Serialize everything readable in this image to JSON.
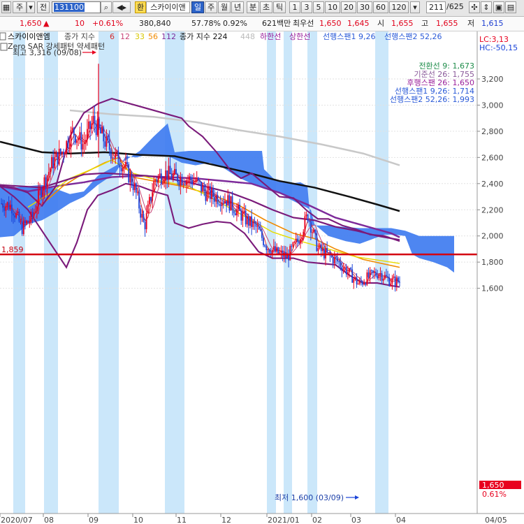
{
  "toolbar": {
    "market": "주",
    "prefix": "전",
    "code": "131100",
    "won_label": "환",
    "stock_name": "스카이이앤",
    "periods": [
      "일",
      "주",
      "월",
      "년",
      "분",
      "초",
      "틱"
    ],
    "intervals": [
      "1",
      "3",
      "5",
      "10",
      "20",
      "30",
      "60",
      "120"
    ],
    "page_current": "211",
    "page_total": "/625"
  },
  "quote": {
    "price": "1,650",
    "change_arrow": "▲",
    "change": "10",
    "change_pct": "+0.61%",
    "volume": "380,840",
    "turnover_pct": "57.78%",
    "ratio_pct": "0.92%",
    "amount": "621백만",
    "bid_label": "최우선",
    "bid1": "1,650",
    "bid2": "1,645",
    "open_label": "시",
    "open": "1,655",
    "high_label": "고",
    "high": "1,655",
    "low_label": "저",
    "low": "1,615"
  },
  "legend": {
    "name": "스카이이앤엠",
    "ma_label": "종가 지수",
    "ma_periods": [
      "6",
      "12",
      "33",
      "56",
      "112"
    ],
    "ma2_label": "종가 지수 224",
    "ma3_value": "448",
    "lower_band": "하한선",
    "upper_band": "상한선",
    "span1_label": "선행스팬1 9,26",
    "span2_label": "선행스팬2 52,26",
    "line2": "Zero SAR 강세패턴  약세패턴",
    "peak_label": "최고 3,316 (09/08)",
    "low_label": "최저 1,600 (03/09)",
    "lc": "LC:3,13",
    "hc": "HC:-50,15",
    "ichimoku": [
      "전환선 9: 1,673",
      "기준선 26: 1,755",
      "후행스팬 26: 1,650",
      "선행스팬1 9,26: 1,714",
      "선행스팬2 52,26: 1,993"
    ],
    "hline_label": "1,859",
    "last_price_tag": "1,650",
    "last_pct_tag": "0.61%"
  },
  "colors": {
    "up": "#e8001e",
    "down": "#1b44d8",
    "cloud": "#3f7cf0",
    "highlight": "#cbe7fa",
    "bollinger": "#7a1a7a",
    "ma6": "#d62d2d",
    "ma12": "#c84678",
    "ma33": "#e8dc00",
    "ma56": "#f08a00",
    "ma112": "#7d2a9a",
    "ma224": "#111111",
    "ma448": "#c8c8c8",
    "hline": "#d40010",
    "ichimoku_text": [
      "#1e8c4a",
      "#8a5a9a",
      "#9a1e9a",
      "#2a5ad8",
      "#2a5ad8"
    ]
  },
  "chart_data": {
    "type": "candlestick",
    "y_ticks": [
      3200,
      3000,
      2800,
      2600,
      2400,
      2200,
      2000,
      1800,
      1600
    ],
    "x_ticks": [
      "2020/07",
      "08",
      "09",
      "10",
      "11",
      "12",
      "2021/01",
      "02",
      "03",
      "04",
      "04/05"
    ],
    "ylim": [
      1580,
      3330
    ],
    "close_series": [
      {
        "x": "2020/07",
        "y": 2250
      },
      {
        "x": "2020/07",
        "y": 2230
      },
      {
        "x": "07/20",
        "y": 2060
      },
      {
        "x": "07/27",
        "y": 2140
      },
      {
        "x": "08",
        "y": 2380
      },
      {
        "x": "08/10",
        "y": 2560
      },
      {
        "x": "08/17",
        "y": 2650
      },
      {
        "x": "08/24",
        "y": 2800
      },
      {
        "x": "08/31",
        "y": 2700
      },
      {
        "x": "09/07",
        "y": 2880
      },
      {
        "x": "09/14",
        "y": 2740
      },
      {
        "x": "09/21",
        "y": 2620
      },
      {
        "x": "09/28",
        "y": 2540
      },
      {
        "x": "10/05",
        "y": 2380
      },
      {
        "x": "10/12",
        "y": 2070
      },
      {
        "x": "10/19",
        "y": 2430
      },
      {
        "x": "10/26",
        "y": 2480
      },
      {
        "x": "11/02",
        "y": 2450
      },
      {
        "x": "11/09",
        "y": 2440
      },
      {
        "x": "11/16",
        "y": 2420
      },
      {
        "x": "11/23",
        "y": 2330
      },
      {
        "x": "11/30",
        "y": 2300
      },
      {
        "x": "12/07",
        "y": 2280
      },
      {
        "x": "12/14",
        "y": 2200
      },
      {
        "x": "12/21",
        "y": 2120
      },
      {
        "x": "12/28",
        "y": 2060
      },
      {
        "x": "2021/01",
        "y": 1920
      },
      {
        "x": "01/11",
        "y": 1870
      },
      {
        "x": "01/18",
        "y": 1840
      },
      {
        "x": "01/25",
        "y": 1960
      },
      {
        "x": "02",
        "y": 2160
      },
      {
        "x": "02/08",
        "y": 1900
      },
      {
        "x": "02/15",
        "y": 1850
      },
      {
        "x": "02/22",
        "y": 1800
      },
      {
        "x": "03",
        "y": 1720
      },
      {
        "x": "03/09",
        "y": 1630
      },
      {
        "x": "03/16",
        "y": 1690
      },
      {
        "x": "03/23",
        "y": 1720
      },
      {
        "x": "03/30",
        "y": 1660
      },
      {
        "x": "04",
        "y": 1650
      }
    ],
    "ma224": [
      {
        "x": "2020/07",
        "y": 2720
      },
      {
        "x": "08",
        "y": 2620
      },
      {
        "x": "09",
        "y": 2630
      },
      {
        "x": "10",
        "y": 2620
      },
      {
        "x": "11",
        "y": 2600
      },
      {
        "x": "12",
        "y": 2540
      },
      {
        "x": "2021/01",
        "y": 2440
      },
      {
        "x": "02",
        "y": 2360
      },
      {
        "x": "03",
        "y": 2260
      },
      {
        "x": "04",
        "y": 2190
      }
    ],
    "ma448": [
      {
        "x": "08",
        "y": 2960
      },
      {
        "x": "09",
        "y": 2930
      },
      {
        "x": "10",
        "y": 2900
      },
      {
        "x": "11",
        "y": 2850
      },
      {
        "x": "12",
        "y": 2780
      },
      {
        "x": "2021/01",
        "y": 2700
      },
      {
        "x": "02",
        "y": 2640
      },
      {
        "x": "03",
        "y": 2570
      },
      {
        "x": "04",
        "y": 2530
      }
    ],
    "bollinger_upper": [
      {
        "x": "2020/07",
        "y": 2380
      },
      {
        "x": "08",
        "y": 2400
      },
      {
        "x": "09",
        "y": 3030
      },
      {
        "x": "10",
        "y": 2890
      },
      {
        "x": "11",
        "y": 2860
      },
      {
        "x": "12",
        "y": 2480
      },
      {
        "x": "2021/01",
        "y": 2390
      },
      {
        "x": "02",
        "y": 2180
      },
      {
        "x": "03",
        "y": 2080
      },
      {
        "x": "04",
        "y": 1960
      }
    ],
    "bollinger_lower": [
      {
        "x": "2020/07",
        "y": 2380
      },
      {
        "x": "08",
        "y": 1770
      },
      {
        "x": "09",
        "y": 2400
      },
      {
        "x": "10",
        "y": 2100
      },
      {
        "x": "11",
        "y": 2060
      },
      {
        "x": "12",
        "y": 2100
      },
      {
        "x": "2021/01",
        "y": 1820
      },
      {
        "x": "02",
        "y": 1800
      },
      {
        "x": "03",
        "y": 1680
      },
      {
        "x": "04",
        "y": 1620
      }
    ],
    "ichimoku_cloud_top": [
      {
        "x": "2020/07",
        "y": 2380
      },
      {
        "x": "08",
        "y": 2360
      },
      {
        "x": "09",
        "y": 2520
      },
      {
        "x": "10",
        "y": 2760
      },
      {
        "x": "11",
        "y": 2650
      },
      {
        "x": "12",
        "y": 2650
      },
      {
        "x": "2021/01",
        "y": 2420
      },
      {
        "x": "02",
        "y": 2060
      },
      {
        "x": "03",
        "y": 2060
      },
      {
        "x": "04",
        "y": 2000
      }
    ],
    "ichimoku_cloud_bottom": [
      {
        "x": "2020/07",
        "y": 2000
      },
      {
        "x": "08",
        "y": 2200
      },
      {
        "x": "09",
        "y": 2320
      },
      {
        "x": "10",
        "y": 2600
      },
      {
        "x": "11",
        "y": 2530
      },
      {
        "x": "12",
        "y": 2380
      },
      {
        "x": "2021/01",
        "y": 2240
      },
      {
        "x": "02",
        "y": 1980
      },
      {
        "x": "03",
        "y": 1870
      },
      {
        "x": "04",
        "y": 1720
      }
    ],
    "horizontal_line": 1859,
    "peak": {
      "label": "최고 3,316 (09/08)",
      "y": 3316
    },
    "trough": {
      "label": "최저 1,600 (03/09)",
      "y": 1600
    }
  }
}
